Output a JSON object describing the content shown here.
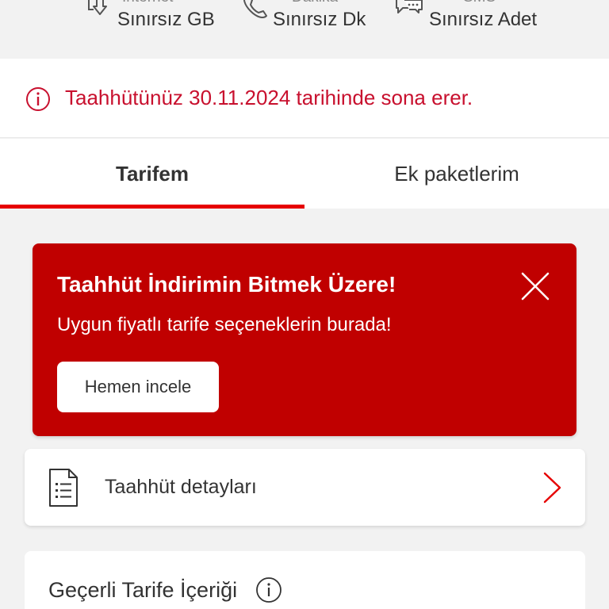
{
  "usage": [
    {
      "label": "İnternet",
      "value": "Sınırsız GB",
      "icon": "download-icon"
    },
    {
      "label": "Dakika",
      "value": "Sınırsız Dk",
      "icon": "phone-icon"
    },
    {
      "label": "SMS",
      "value": "Sınırsız Adet",
      "icon": "chat-icon"
    }
  ],
  "notice": {
    "text": "Taahhütünüz 30.11.2024 tarihinde sona erer.",
    "icon": "info-icon",
    "color": "#c8102e"
  },
  "tabs": [
    {
      "label": "Tarifem",
      "active": true
    },
    {
      "label": "Ek paketlerim",
      "active": false
    }
  ],
  "promo": {
    "title": "Taahhüt İndirimin Bitmek Üzere!",
    "subtitle": "Uygun fiyatlı tarife seçeneklerin burada!",
    "button_label": "Hemen incele",
    "background": "#c00000"
  },
  "detail_row": {
    "label": "Taahhüt detayları",
    "icon": "document-icon"
  },
  "tariff_card": {
    "title": "Geçerli Tarife İçeriği",
    "icon": "info-icon"
  },
  "colors": {
    "accent": "#e60000",
    "background": "#f2f2f2"
  }
}
